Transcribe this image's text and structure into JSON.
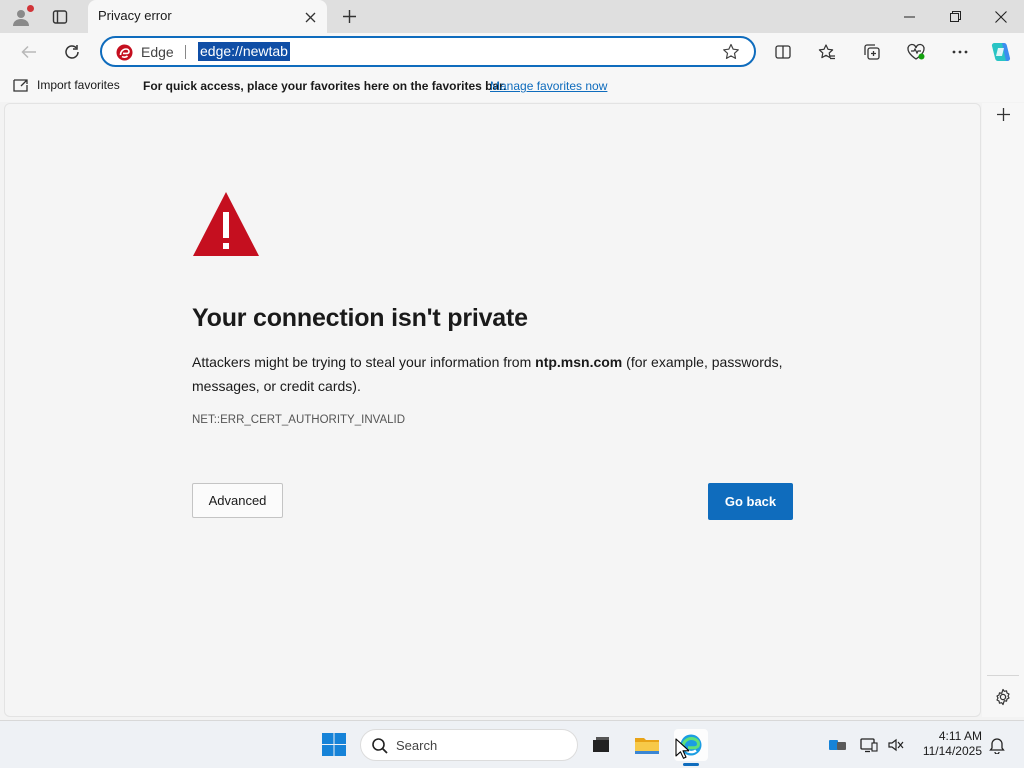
{
  "tab": {
    "title": "Privacy error"
  },
  "addressbar": {
    "site_label": "Edge",
    "url": "edge://newtab"
  },
  "favorites_bar": {
    "import_label": "Import favorites",
    "message": "For quick access, place your favorites here on the favorites bar.",
    "manage_link": "Manage favorites now"
  },
  "error_page": {
    "title": "Your connection isn't private",
    "desc_before": "Attackers might be trying to steal your information from ",
    "desc_host": "ntp.msn.com",
    "desc_after": " (for example, passwords, messages, or credit cards).",
    "error_code": "NET::ERR_CERT_AUTHORITY_INVALID",
    "advanced_label": "Advanced",
    "go_back_label": "Go back"
  },
  "taskbar": {
    "search_placeholder": "Search",
    "time": "4:11 AM",
    "date": "11/14/2025"
  },
  "colors": {
    "accent": "#0f6cbd",
    "warning_red": "#c50f1f"
  }
}
